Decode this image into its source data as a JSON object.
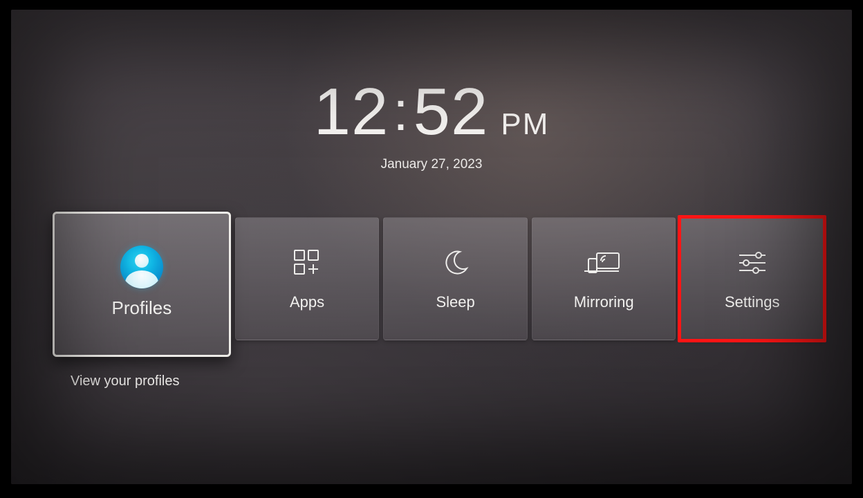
{
  "clock": {
    "hour": "12",
    "minute": "52",
    "ampm": "PM",
    "date": "January 27, 2023"
  },
  "tiles": {
    "profiles": {
      "label": "Profiles",
      "icon": "profile-icon"
    },
    "apps": {
      "label": "Apps",
      "icon": "apps-icon"
    },
    "sleep": {
      "label": "Sleep",
      "icon": "moon-icon"
    },
    "mirroring": {
      "label": "Mirroring",
      "icon": "mirroring-icon"
    },
    "settings": {
      "label": "Settings",
      "icon": "sliders-icon"
    }
  },
  "focused_tile": "profiles",
  "annotated_tile": "settings",
  "caption": "View your profiles",
  "colors": {
    "highlight_annotation": "#ff1515",
    "profile_accent": "#11b8e6",
    "tile_bg": "#8a858a",
    "text": "#f3f3f3"
  }
}
